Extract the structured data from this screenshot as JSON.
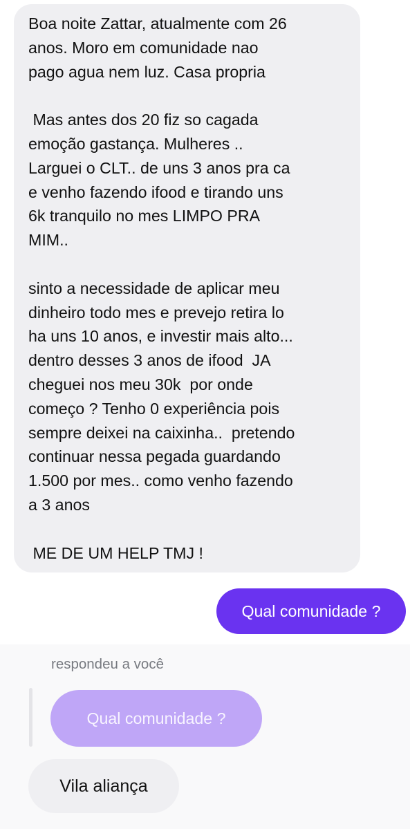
{
  "messages": {
    "incoming_long": "Boa noite Zattar, atualmente com 26\nanos. Moro em comunidade nao\npago agua nem luz. Casa propria\n\n Mas antes dos 20 fiz so cagada\nemoção gastança. Mulheres ..\nLarguei o CLT.. de uns 3 anos pra ca\ne venho fazendo ifood e tirando uns\n6k tranquilo no mes LIMPO PRA\nMIM..\n\nsinto a necessidade de aplicar meu\ndinheiro todo mes e prevejo retira lo\nha uns 10 anos, e investir mais alto...\ndentro desses 3 anos de ifood  JA\ncheguei nos meu 30k  por onde\ncomeço ? Tenho 0 experiência pois\nsempre deixei na caixinha..  pretendo\ncontinuar nessa pegada guardando\n1.500 por mes.. como venho fazendo\na 3 anos\n\n ME DE UM HELP TMJ !",
    "outgoing": "Qual comunidade ?",
    "reply_label": "respondeu a você",
    "quoted": "Qual comunidade ?",
    "reply": "Vila aliança"
  },
  "colors": {
    "incoming_bubble": "#efeff2",
    "outgoing_bubble": "#6a33f0",
    "quoted_bubble": "#bfa6f7",
    "secondary_text": "#777a80"
  }
}
